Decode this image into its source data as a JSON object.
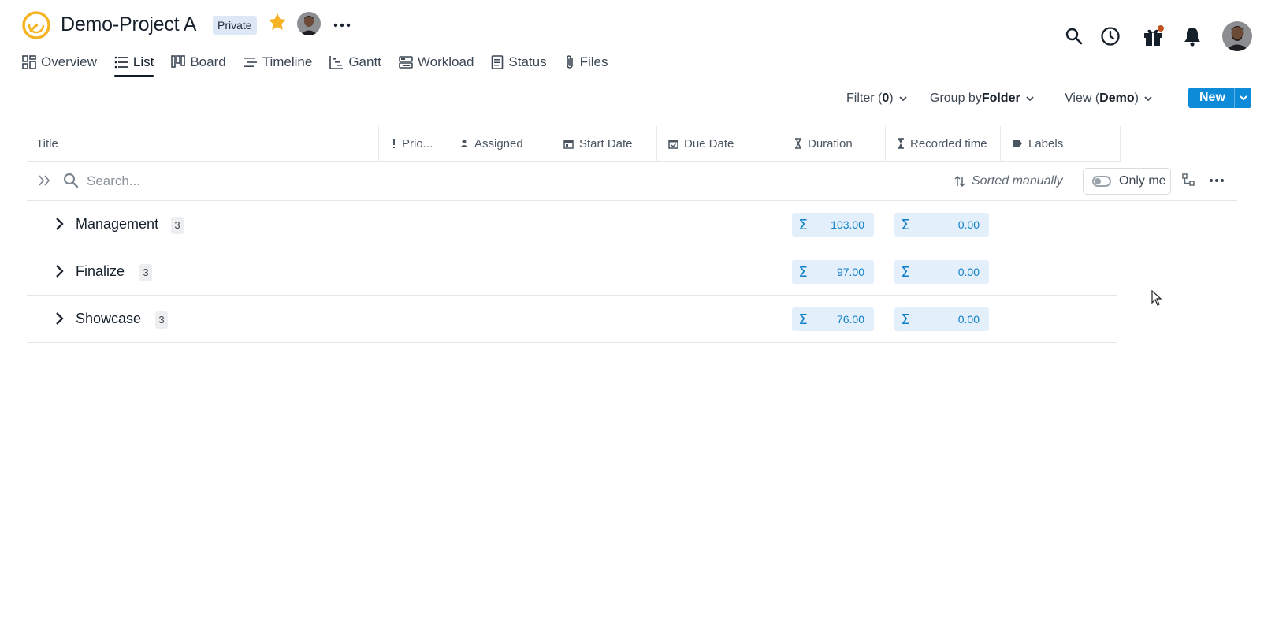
{
  "project": {
    "title": "Demo-Project A",
    "visibility": "Private",
    "favorite_icon": "star-icon",
    "accent_color": "#f6b324"
  },
  "tabs": [
    {
      "label": "Overview",
      "icon": "overview-icon",
      "active": false
    },
    {
      "label": "List",
      "icon": "list-icon",
      "active": true
    },
    {
      "label": "Board",
      "icon": "board-icon",
      "active": false
    },
    {
      "label": "Timeline",
      "icon": "timeline-icon",
      "active": false
    },
    {
      "label": "Gantt",
      "icon": "gantt-icon",
      "active": false
    },
    {
      "label": "Workload",
      "icon": "workload-icon",
      "active": false
    },
    {
      "label": "Status",
      "icon": "status-icon",
      "active": false
    },
    {
      "label": "Files",
      "icon": "paperclip-icon",
      "active": false
    }
  ],
  "header_icons": [
    "search-icon",
    "clock-icon",
    "gift-icon",
    "bell-icon",
    "user-avatar"
  ],
  "toolbar": {
    "filter_label": "Filter (",
    "filter_count": "0",
    "filter_suffix": ")",
    "group_label": "Group by ",
    "group_value": "Folder",
    "view_label": "View (",
    "view_value": "Demo",
    "view_suffix": ")",
    "new_label": "New",
    "primary_color": "#0d8bd9"
  },
  "columns": [
    {
      "label": "Title",
      "icon": ""
    },
    {
      "label": "Prio...",
      "icon": "exclamation-icon"
    },
    {
      "label": "Assigned",
      "icon": "person-icon"
    },
    {
      "label": "Start Date",
      "icon": "calendar-icon"
    },
    {
      "label": "Due Date",
      "icon": "calendar-check-icon"
    },
    {
      "label": "Duration",
      "icon": "hourglass-icon"
    },
    {
      "label": "Recorded time",
      "icon": "hourglass-filled-icon"
    },
    {
      "label": "Labels",
      "icon": "tag-icon"
    }
  ],
  "search": {
    "placeholder": "Search...",
    "sort_label": "Sorted manually",
    "only_me_label": "Only me"
  },
  "groups": [
    {
      "name": "Management",
      "count": "3",
      "duration": "103.00",
      "recorded": "0.00"
    },
    {
      "name": "Finalize",
      "count": "3",
      "duration": "97.00",
      "recorded": "0.00"
    },
    {
      "name": "Showcase",
      "count": "3",
      "duration": "76.00",
      "recorded": "0.00"
    }
  ]
}
